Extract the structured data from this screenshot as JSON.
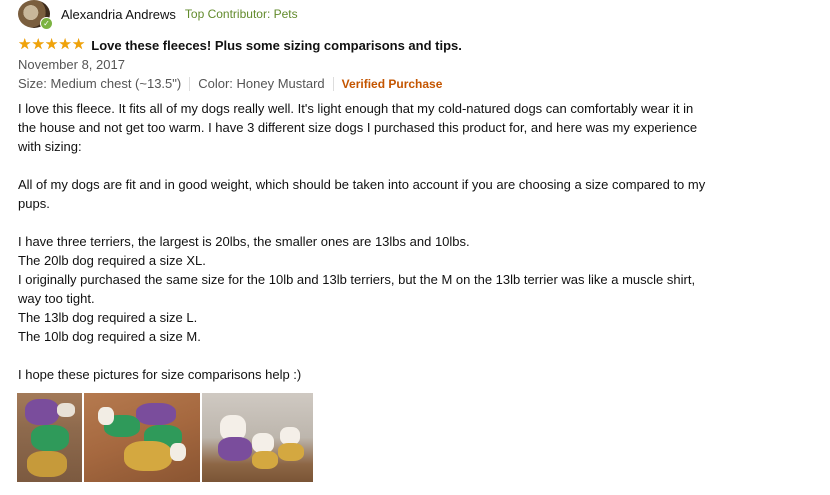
{
  "profile": {
    "name": "Alexandria Andrews",
    "contributor_badge": "Top Contributor: Pets"
  },
  "review": {
    "rating": 5,
    "rating_max": 5,
    "title": "Love these fleeces! Plus some sizing comparisons and tips.",
    "date": "November 8, 2017",
    "size": "Size: Medium chest (~13.5\")",
    "color": "Color: Honey Mustard",
    "verified": "Verified Purchase",
    "paragraphs": [
      "I love this fleece. It fits all of my dogs really well. It's light enough that my cold-natured dogs can comfortably wear it in the house and not get too warm. I have 3 different size dogs I purchased this product for, and here was my experience with sizing:",
      "",
      "All of my dogs are fit and in good weight, which should be taken into account if you are choosing a size compared to my pups.",
      "",
      "I have three terriers, the largest is 20lbs, the smaller ones are 13lbs and 10lbs.",
      "The 20lb dog required a size XL.",
      "I originally purchased the same size for the 10lb and 13lb terriers, but the M on the 13lb terrier was like a muscle shirt, way too tight.",
      "The 13lb dog required a size L.",
      "The 10lb dog required a size M.",
      "",
      "I hope these pictures for size comparisons help :)"
    ]
  },
  "colors": {
    "star": "#f0a30a",
    "contributor": "#628b2c",
    "verified": "#c45500",
    "meta_text": "#555555"
  },
  "icons": {
    "avatar_badge": "check-badge-icon",
    "star": "star-icon"
  }
}
